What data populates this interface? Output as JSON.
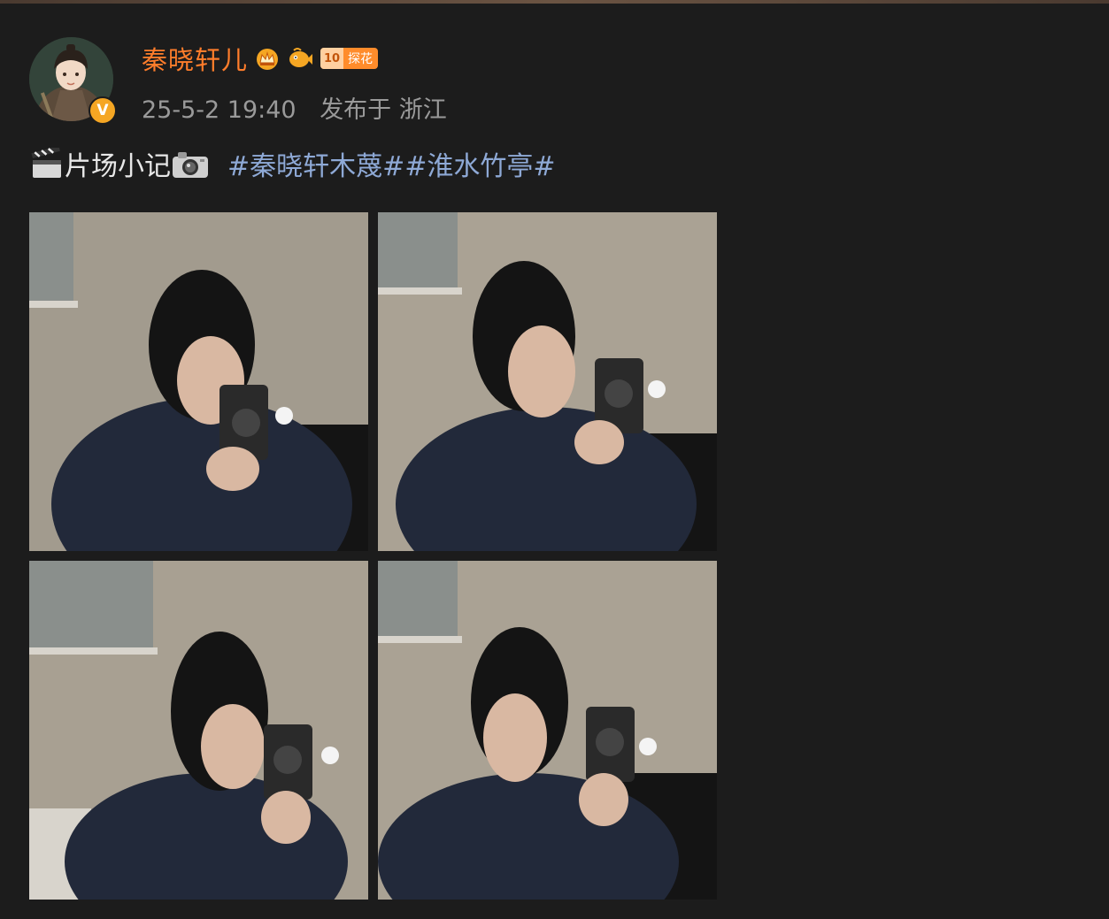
{
  "post": {
    "username": "秦晓轩儿",
    "level_badge": {
      "level": "10",
      "label": "探花"
    },
    "timestamp": "25-5-2 19:40",
    "location": "发布于 浙江",
    "content": {
      "text": "片场小记",
      "topics": [
        "#秦晓轩木蔑#",
        "#淮水竹亭#"
      ]
    },
    "icons": {
      "avatar_badge": "verified-badge-icon",
      "crown": "crown-badge-icon",
      "fish": "fish-badge-icon",
      "clapper": "clapperboard-icon",
      "camera": "camera-icon"
    },
    "colors": {
      "background": "#1c1c1c",
      "username": "#ff7d2b",
      "topic": "#8ea9d6",
      "meta": "#9a9a9a",
      "verified": "#f5a623"
    },
    "photos": [
      {
        "name": "photo-1"
      },
      {
        "name": "photo-2"
      },
      {
        "name": "photo-3"
      },
      {
        "name": "photo-4"
      }
    ]
  }
}
